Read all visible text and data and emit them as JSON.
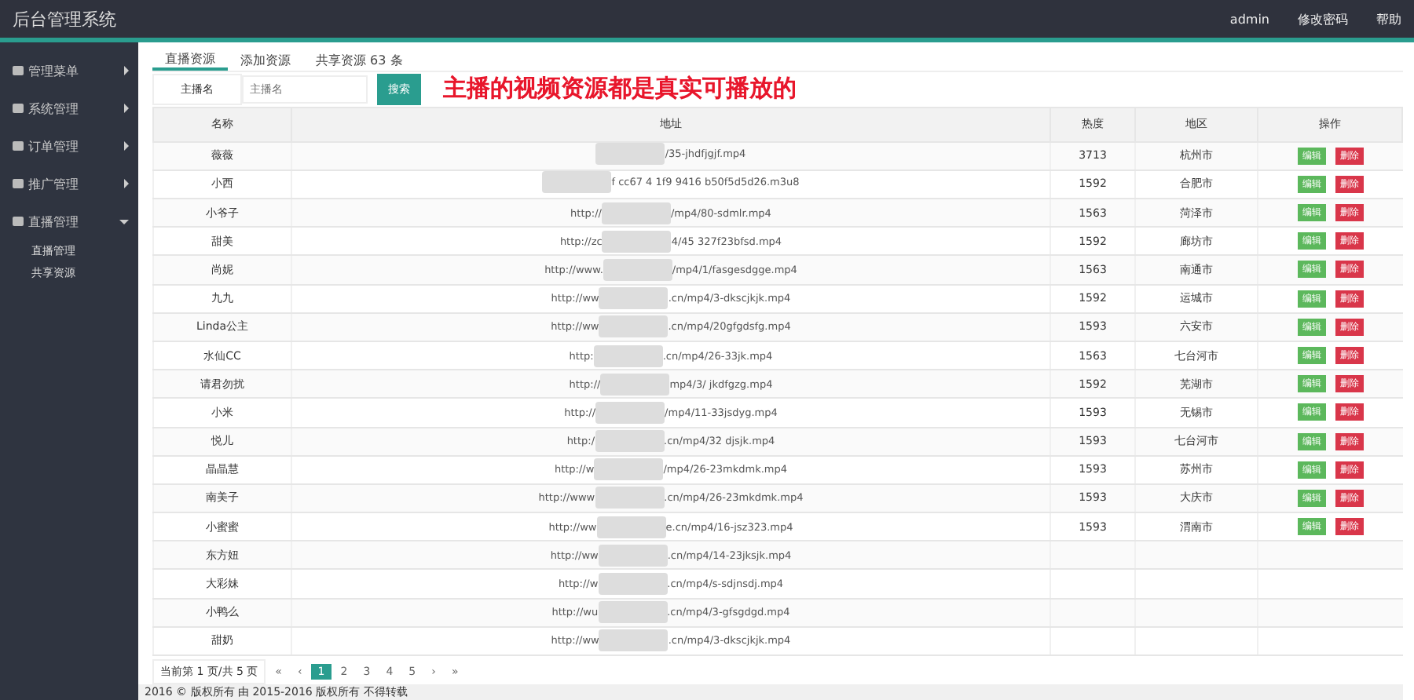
{
  "app_title": "后台管理系统",
  "top_links": [
    "admin",
    "修改密码",
    "帮助"
  ],
  "sidebar": [
    {
      "label": "管理菜单",
      "expanded": false
    },
    {
      "label": "系统管理",
      "expanded": false
    },
    {
      "label": "订单管理",
      "expanded": false
    },
    {
      "label": "推广管理",
      "expanded": false
    },
    {
      "label": "直播管理",
      "expanded": true,
      "children": [
        {
          "label": "直播管理"
        },
        {
          "label": "共享资源"
        }
      ]
    }
  ],
  "tabs": [
    {
      "label": "直播资源",
      "selected": true
    },
    {
      "label": "添加资源",
      "selected": false
    },
    {
      "label": "共享资源 63 条",
      "selected": false
    }
  ],
  "search": {
    "label": "主播名",
    "placeholder": "主播名",
    "button": "搜索"
  },
  "caption": "主播的视频资源都是真实可播放的",
  "table": {
    "columns": [
      "名称",
      "地址",
      "热度",
      "地区",
      "操作"
    ],
    "rows": [
      {
        "name": "薇薇",
        "url_prefix": "",
        "url_suffix": "/35-jhdfjgjf.mp4",
        "hot": "3713",
        "region": "杭州市",
        "edit": "编辑",
        "delete": "删除"
      },
      {
        "name": "小西",
        "url_prefix": "",
        "url_suffix": "f cc67 4 1f9 9416 b50f5d5d26.m3u8",
        "hot": "1592",
        "region": "合肥市",
        "edit": "编辑",
        "delete": "删除"
      },
      {
        "name": "小爷子",
        "url_prefix": "http://",
        "url_suffix": "/mp4/80-sdmlr.mp4",
        "hot": "1563",
        "region": "菏泽市",
        "edit": "编辑",
        "delete": "删除"
      },
      {
        "name": "甜美",
        "url_prefix": "http://zc",
        "url_suffix": "4/45 327f23bfsd.mp4",
        "hot": "1592",
        "region": "廊坊市",
        "edit": "编辑",
        "delete": "删除"
      },
      {
        "name": "尚妮",
        "url_prefix": "http://www.",
        "url_suffix": "/mp4/1/fasgesdgge.mp4",
        "hot": "1563",
        "region": "南通市",
        "edit": "编辑",
        "delete": "删除"
      },
      {
        "name": "九九",
        "url_prefix": "http://ww",
        "url_suffix": ".cn/mp4/3-dkscjkjk.mp4",
        "hot": "1592",
        "region": "运城市",
        "edit": "编辑",
        "delete": "删除"
      },
      {
        "name": "Linda公主",
        "url_prefix": "http://ww",
        "url_suffix": ".cn/mp4/20gfgdsfg.mp4",
        "hot": "1593",
        "region": "六安市",
        "edit": "编辑",
        "delete": "删除"
      },
      {
        "name": "水仙CC",
        "url_prefix": "http:",
        "url_suffix": ".cn/mp4/26-33jk.mp4",
        "hot": "1563",
        "region": "七台河市",
        "edit": "编辑",
        "delete": "删除"
      },
      {
        "name": "请君勿扰",
        "url_prefix": "http://",
        "url_suffix": "mp4/3/ jkdfgzg.mp4",
        "hot": "1592",
        "region": "芜湖市",
        "edit": "编辑",
        "delete": "删除"
      },
      {
        "name": "小米",
        "url_prefix": "http://",
        "url_suffix": "/mp4/11-33jsdyg.mp4",
        "hot": "1593",
        "region": "无锡市",
        "edit": "编辑",
        "delete": "删除"
      },
      {
        "name": "悦儿",
        "url_prefix": "http:/",
        "url_suffix": ".cn/mp4/32 djsjk.mp4",
        "hot": "1593",
        "region": "七台河市",
        "edit": "编辑",
        "delete": "删除"
      },
      {
        "name": "晶晶慧",
        "url_prefix": "http://w",
        "url_suffix": "/mp4/26-23mkdmk.mp4",
        "hot": "1593",
        "region": "苏州市",
        "edit": "编辑",
        "delete": "删除"
      },
      {
        "name": "南美子",
        "url_prefix": "http://www",
        "url_suffix": ".cn/mp4/26-23mkdmk.mp4",
        "hot": "1593",
        "region": "大庆市",
        "edit": "编辑",
        "delete": "删除"
      },
      {
        "name": "小蜜蜜",
        "url_prefix": "http://ww",
        "url_suffix": "e.cn/mp4/16-jsz323.mp4",
        "hot": "1593",
        "region": "渭南市",
        "edit": "编辑",
        "delete": "删除"
      },
      {
        "name": "东方妞",
        "url_prefix": "http://ww",
        "url_suffix": ".cn/mp4/14-23jksjk.mp4"
      },
      {
        "name": "大彩妹",
        "url_prefix": "http://w",
        "url_suffix": ".cn/mp4/s-sdjnsdj.mp4"
      },
      {
        "name": "小鸭么",
        "url_prefix": "http://wu",
        "url_suffix": ".cn/mp4/3-gfsgdgd.mp4"
      },
      {
        "name": "甜奶",
        "url_prefix": "http://ww",
        "url_suffix": ".cn/mp4/3-dkscjkjk.mp4"
      }
    ]
  },
  "pagination": {
    "info": "当前第 1 页/共 5 页",
    "pages": [
      {
        "label": "«",
        "selected": false
      },
      {
        "label": "‹",
        "selected": false
      },
      {
        "label": "1",
        "selected": true
      },
      {
        "label": "2",
        "selected": false
      },
      {
        "label": "3",
        "selected": false
      },
      {
        "label": "4",
        "selected": false
      },
      {
        "label": "5",
        "selected": false
      },
      {
        "label": "›",
        "selected": false
      },
      {
        "label": "»",
        "selected": false
      }
    ]
  },
  "footer": "2016 © 版权所有 由 2015-2016 版权所有 不得转载"
}
